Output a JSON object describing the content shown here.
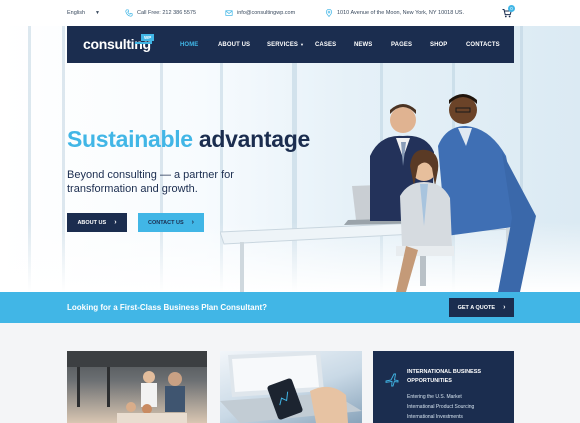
{
  "topbar": {
    "language": "English",
    "phone": "Call Free: 212 386 5575",
    "email": "info@consultingwp.com",
    "address": "1010 Avenue of the Moon, New York, NY 10018 US.",
    "cart_count": "0"
  },
  "brand": {
    "logo_text": "consulting",
    "logo_badge": "WP",
    "accent": "#41b6e6",
    "navy": "#1b2d4f"
  },
  "nav": {
    "items": [
      {
        "label": "HOME"
      },
      {
        "label": "ABOUT US"
      },
      {
        "label": "SERVICES"
      },
      {
        "label": "CASES"
      },
      {
        "label": "NEWS"
      },
      {
        "label": "PAGES"
      },
      {
        "label": "SHOP"
      },
      {
        "label": "CONTACTS"
      }
    ],
    "active": "HOME"
  },
  "hero": {
    "title_accent": "Sustainable",
    "title_rest": "advantage",
    "subtitle": "Beyond consulting — a partner for transformation and growth.",
    "btn_about": "ABOUT US",
    "btn_contact": "CONTACT US"
  },
  "cta": {
    "text": "Looking for a First-Class Business Plan Consultant?",
    "button": "GET A QUOTE"
  },
  "card3": {
    "title": "INTERNATIONAL BUSINESS OPPORTUNITIES",
    "lines": [
      "Entering the U.S. Market",
      "International Product Sourcing",
      "International Investments"
    ]
  },
  "icons": {
    "phone": "phone-icon",
    "email": "envelope-icon",
    "address": "map-pin-icon",
    "cart": "cart-icon",
    "plane": "plane-icon"
  }
}
